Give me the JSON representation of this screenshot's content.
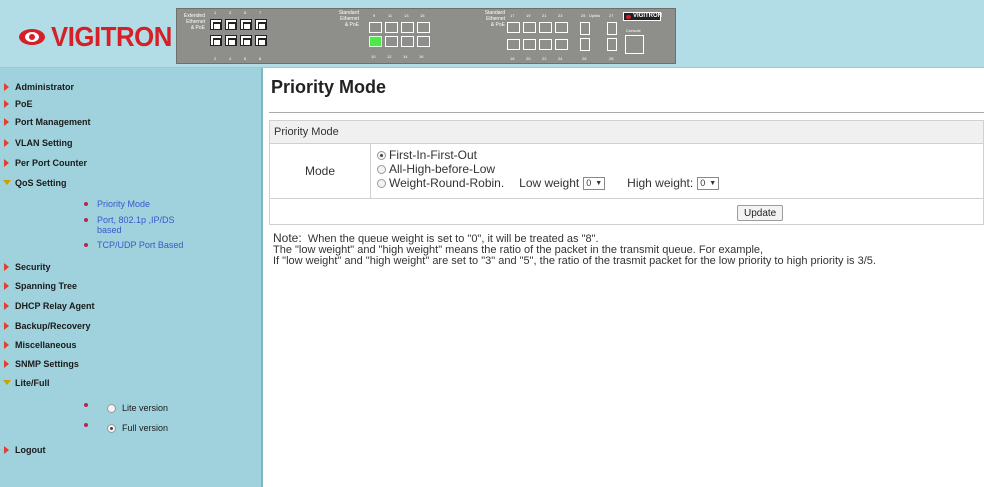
{
  "header": {
    "logo_text": "VIGITRON",
    "panel": {
      "extended_label": "Extended\nEthernet\n& PoE",
      "extended_top_numbers": [
        "1",
        "3",
        "5",
        "7"
      ],
      "extended_bottom_numbers": [
        "2",
        "4",
        "6",
        "8"
      ],
      "standard_label_1": "Standard\nEthernet\n& PoE",
      "standard1_top_numbers": [
        "9",
        "11",
        "13",
        "15"
      ],
      "standard1_bottom_numbers": [
        "10",
        "12",
        "14",
        "16"
      ],
      "standard_label_2": "Standard\nEthernet\n& PoE",
      "standard2_top_numbers": [
        "17",
        "19",
        "21",
        "23"
      ],
      "standard2_bottom_numbers": [
        "18",
        "20",
        "22",
        "24"
      ],
      "uplink_label": "Uplink",
      "uplink_numbers_top": [
        "25",
        "27"
      ],
      "uplink_numbers_bottom": [
        "26",
        "28"
      ],
      "mini_logo": "VIGITRON",
      "console_label": "Console",
      "lit_port": "10"
    }
  },
  "sidebar": {
    "items": [
      {
        "label": "Administrator",
        "state": "collapsed"
      },
      {
        "label": "PoE",
        "state": "collapsed"
      },
      {
        "label": "Port Management",
        "state": "collapsed"
      },
      {
        "label": "VLAN Setting",
        "state": "collapsed"
      },
      {
        "label": "Per Port Counter",
        "state": "collapsed"
      },
      {
        "label": "QoS Setting",
        "state": "expanded"
      },
      {
        "label": "Security",
        "state": "collapsed"
      },
      {
        "label": "Spanning Tree",
        "state": "collapsed"
      },
      {
        "label": "DHCP Relay Agent",
        "state": "collapsed"
      },
      {
        "label": "Backup/Recovery",
        "state": "collapsed"
      },
      {
        "label": "Miscellaneous",
        "state": "collapsed"
      },
      {
        "label": "SNMP Settings",
        "state": "collapsed"
      },
      {
        "label": "Lite/Full",
        "state": "expanded"
      },
      {
        "label": "Logout",
        "state": "collapsed"
      }
    ],
    "qos_subitems": [
      {
        "label": "Priority Mode"
      },
      {
        "label": "Port, 802.1p ,IP/DS based"
      },
      {
        "label": "TCP/UDP Port Based"
      }
    ],
    "version_options": [
      {
        "label": "Lite version",
        "selected": false
      },
      {
        "label": "Full version",
        "selected": true
      }
    ]
  },
  "main": {
    "page_title": "Priority Mode",
    "box_header": "Priority Mode",
    "mode_label": "Mode",
    "options": [
      {
        "label": "First-In-First-Out",
        "selected": true
      },
      {
        "label": "All-High-before-Low",
        "selected": false
      },
      {
        "label": "Weight-Round-Robin.",
        "selected": false
      }
    ],
    "low_weight_label": "Low weight",
    "low_weight_value": "0",
    "high_weight_label": "High weight:",
    "high_weight_value": "0",
    "update_button": "Update",
    "note_label": "Note:",
    "note_line1": "When the queue weight is set to \"0\", it will be treated as \"8\".",
    "note_line2": "The \"low weight\" and \"high weight\" means the ratio of the packet in the transmit queue. For example,",
    "note_line3": "If \"low weight\" and \"high weight\" are set to \"3\" and \"5\", the ratio of the trasmit packet for the low priority to high priority is 3/5."
  },
  "colors": {
    "header_bg": "#b3dde6",
    "sidebar_bg": "#9fd2dd",
    "brand_red": "#d61f26",
    "link_blue": "#3a57c9",
    "lit_port_green": "#4ce84c"
  }
}
